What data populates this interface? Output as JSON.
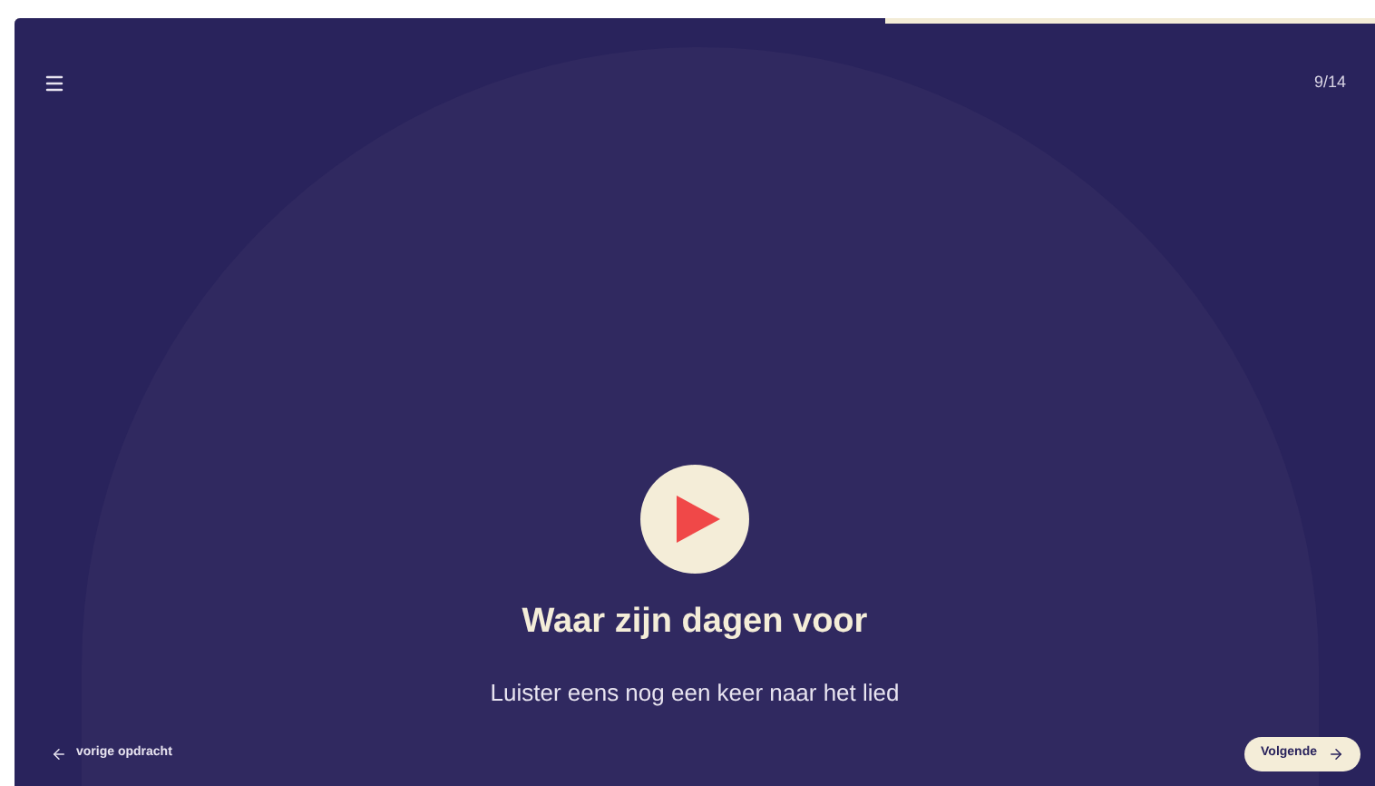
{
  "progress": {
    "level": 0.64
  },
  "counter": "9/14",
  "title": "Waar zijn dagen voor",
  "instruction": "Luister eens nog een keer naar het lied",
  "previous_link": "vorige opdracht",
  "next_button": "Volgende"
}
